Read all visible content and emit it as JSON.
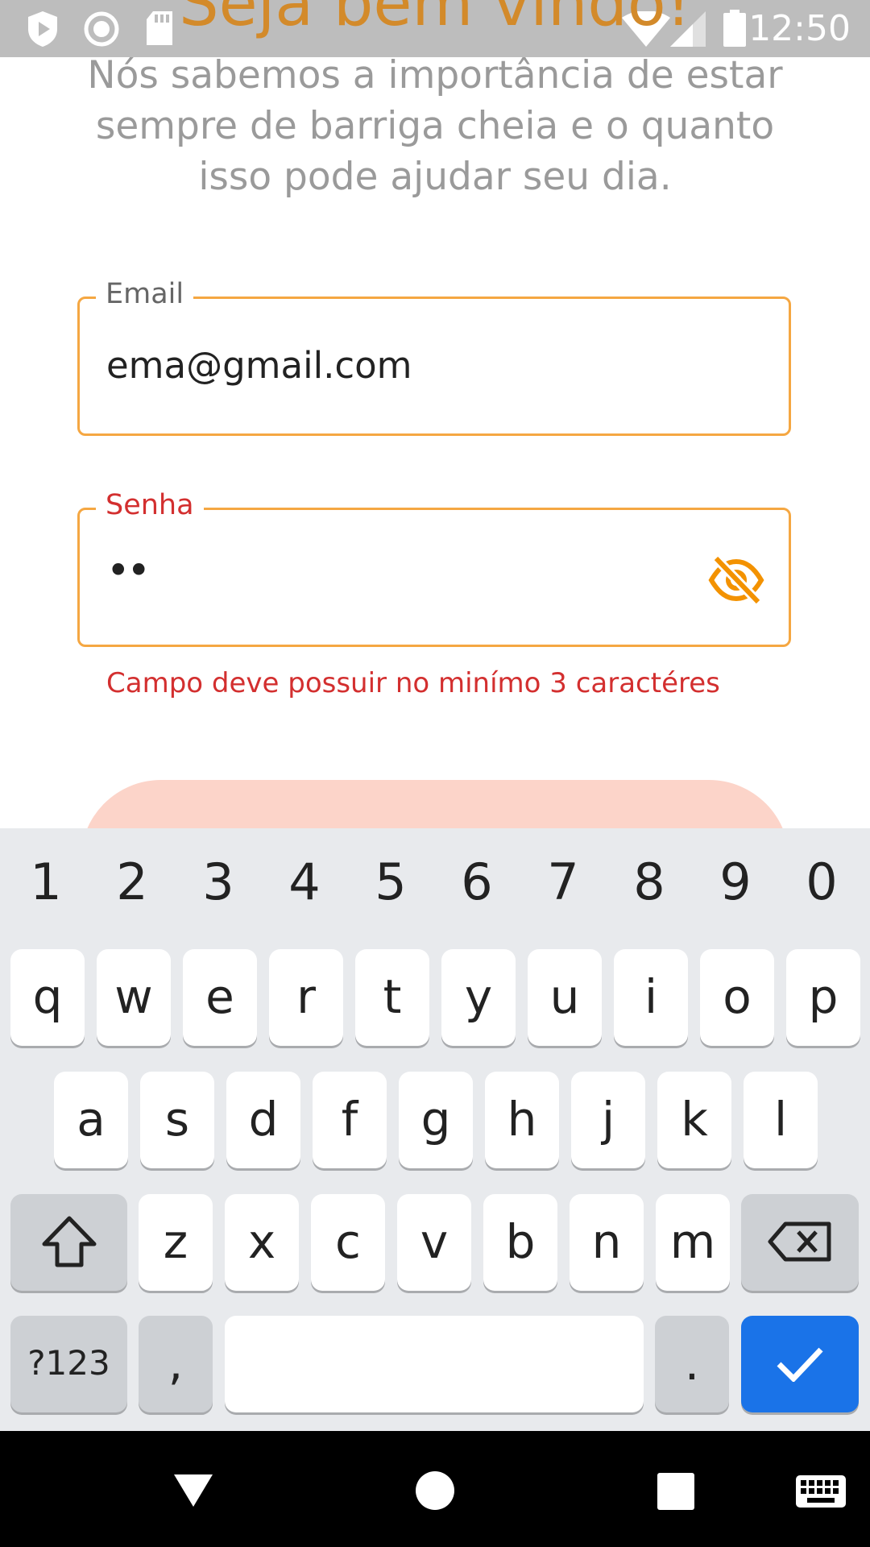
{
  "status_bar": {
    "time": "12:50",
    "icons": [
      "play-protect-icon",
      "record-icon",
      "sd-card-icon",
      "wifi-icon",
      "signal-icon",
      "battery-icon"
    ]
  },
  "page": {
    "welcome_title": "Seja bem vindo!",
    "intro_text": "Nós sabemos a importância de estar sempre de barriga cheia e o quanto isso pode ajudar seu dia."
  },
  "form": {
    "email": {
      "label": "Email",
      "value": "ema@gmail.com",
      "label_color": "#666666"
    },
    "password": {
      "label": "Senha",
      "value": "••",
      "label_color": "#d32f2f",
      "toggle_icon": "eye-off-icon"
    },
    "error": "Campo deve possuir no minímo 3 caractéres",
    "accent_color": "#f5a742",
    "button_color": "#fcd4c9"
  },
  "keyboard": {
    "numbers": [
      "1",
      "2",
      "3",
      "4",
      "5",
      "6",
      "7",
      "8",
      "9",
      "0"
    ],
    "row1": [
      "q",
      "w",
      "e",
      "r",
      "t",
      "y",
      "u",
      "i",
      "o",
      "p"
    ],
    "row2": [
      "a",
      "s",
      "d",
      "f",
      "g",
      "h",
      "j",
      "k",
      "l"
    ],
    "row3": [
      "z",
      "x",
      "c",
      "v",
      "b",
      "n",
      "m"
    ],
    "symbols_key": "?123",
    "comma_key": ",",
    "period_key": ".",
    "shift_icon": "shift-icon",
    "backspace_icon": "backspace-icon",
    "enter_icon": "checkmark-icon"
  },
  "nav_bar": {
    "icons": [
      "back-icon",
      "home-icon",
      "recents-icon",
      "keyboard-switch-icon"
    ]
  }
}
